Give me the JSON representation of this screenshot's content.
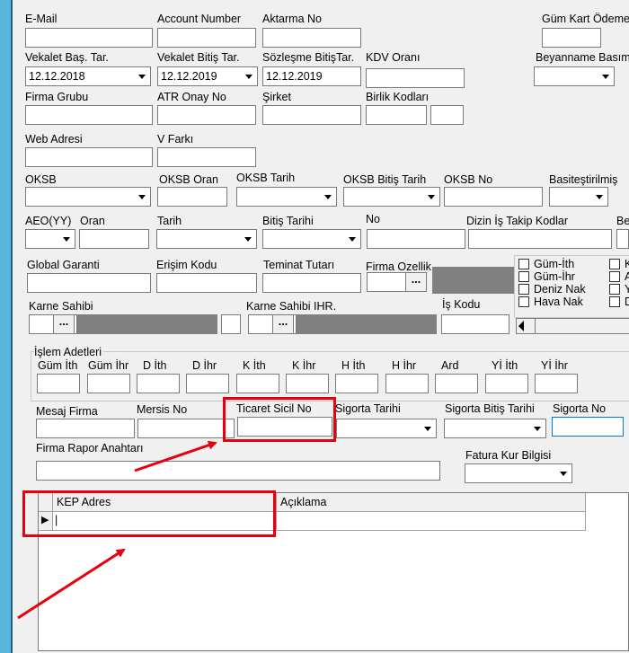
{
  "labels": {
    "email": "E-Mail",
    "account_number": "Account Number",
    "aktarma_no": "Aktarma No",
    "gum_kart": "Güm Kart Ödeme",
    "vekalet_bas": "Vekalet Baş. Tar.",
    "vekalet_bitis": "Vekalet Bitiş Tar.",
    "sozlesme_bitis": "Sözleşme BitişTar.",
    "kdv_orani": "KDV Oranı",
    "beyanname_basim": "Beyanname Basım",
    "firma_grubu": "Firma Grubu",
    "atr_onay": "ATR Onay No",
    "sirket": "Şirket",
    "birlik_kodlari": "Birlik Kodları",
    "web_adresi": "Web Adresi",
    "v_farki": "V Farkı",
    "oksb": "OKSB",
    "oksb_oran": "OKSB Oran",
    "oksb_tarih": "OKSB Tarih",
    "oksb_bitis": "OKSB Bitiş Tarih",
    "oksb_no": "OKSB No",
    "basitestirilmis": "Basiteştirilmiş",
    "aeo": "AEO(YY)",
    "oran": "Oran",
    "tarih": "Tarih",
    "bitis_tarihi": "Bitiş Tarihi",
    "no": "No",
    "dizin": "Dizin İş Takip Kodlar",
    "be": "Be",
    "global_garanti": "Global Garanti",
    "erisim_kodu": "Erişim Kodu",
    "teminat_tutari": "Teminat Tutarı",
    "firma_ozellik": "Firma Ozellik",
    "karne_sahibi": "Karne Sahibi",
    "karne_sahibi_ihr": "Karne Sahibi IHR.",
    "is_kodu": "İş Kodu",
    "islem_adetleri": "İşlem Adetleri",
    "mesaj_firma": "Mesaj Firma",
    "mersis_no": "Mersis No",
    "ticaret_sicil": "Ticaret Sicil No",
    "sigorta_tarihi": "Sigorta Tarihi",
    "sigorta_bitis": "Sigorta Bitiş Tarihi",
    "sigorta_no": "Sigorta No",
    "firma_rapor": "Firma Rapor Anahtarı",
    "fatura_kur": "Fatura Kur Bilgisi"
  },
  "values": {
    "vekalet_bas": "12.12.2018",
    "vekalet_bitis": "12.12.2019",
    "sozlesme_bitis": "12.12.2019"
  },
  "islem_headers": [
    "Güm İth",
    "Güm İhr",
    "D İth",
    "D İhr",
    "K İth",
    "K İhr",
    "H İth",
    "H İhr",
    "Ard",
    "Yİ İth",
    "Yİ İhr"
  ],
  "checkboxes_col1": [
    "Güm-İth",
    "Güm-İhr",
    "Deniz Nak",
    "Hava Nak"
  ],
  "checkboxes_col2": [
    "K",
    "A",
    "Y",
    "D"
  ],
  "ellipsis": "...",
  "grid": {
    "columns": [
      "KEP Adres",
      "Açıklama"
    ],
    "row_indicator": "▶",
    "cursor": "|"
  },
  "colors": {
    "highlight": "#e8000c",
    "accent_strip": "#5bb4dc",
    "focus_border": "#0078d7"
  }
}
